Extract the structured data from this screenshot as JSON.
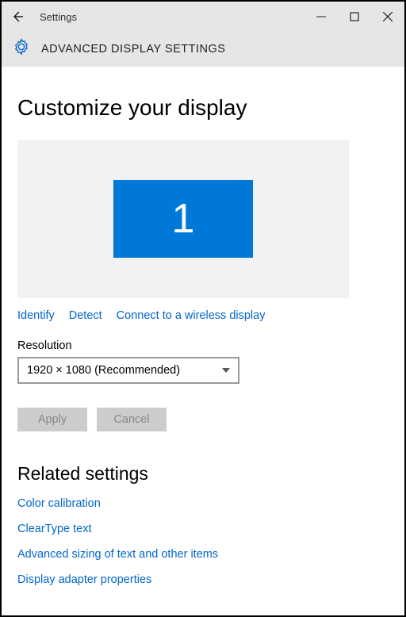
{
  "titlebar": {
    "title": "Settings"
  },
  "header": {
    "title": "ADVANCED DISPLAY SETTINGS"
  },
  "main": {
    "heading": "Customize your display",
    "monitor_number": "1",
    "links": {
      "identify": "Identify",
      "detect": "Detect",
      "wireless": "Connect to a wireless display"
    },
    "resolution": {
      "label": "Resolution",
      "value": "1920 × 1080 (Recommended)"
    },
    "buttons": {
      "apply": "Apply",
      "cancel": "Cancel"
    }
  },
  "related": {
    "heading": "Related settings",
    "links": {
      "color_calibration": "Color calibration",
      "cleartype": "ClearType text",
      "advanced_sizing": "Advanced sizing of text and other items",
      "display_adapter": "Display adapter properties"
    }
  }
}
